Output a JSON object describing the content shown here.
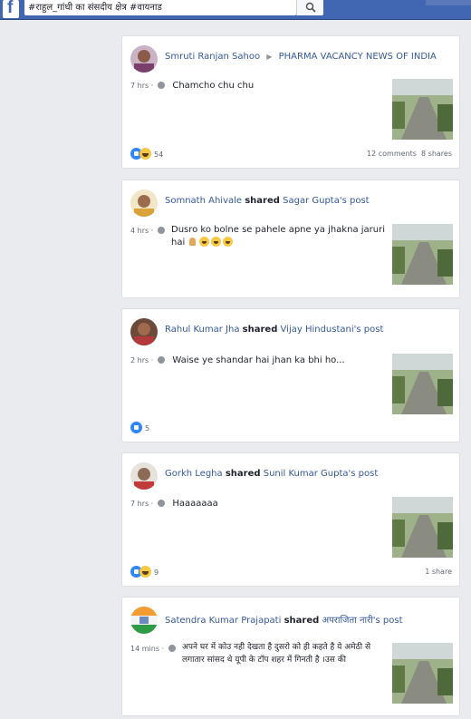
{
  "search": {
    "query": "#राहुल_गांधी का संसदीय क्षेत्र #वायनाड"
  },
  "posts": [
    {
      "author": "Smruti Ranjan Sahoo",
      "connector": "▶",
      "target": "PHARMA VACANCY NEWS OF INDIA",
      "time": "7 hrs",
      "text": "Chamcho chu chu",
      "reactions": "54",
      "comments": "12 comments",
      "shares": "8 shares"
    },
    {
      "author": "Somnath Ahivale",
      "shared_word": "shared",
      "target": "Sagar Gupta's post",
      "time": "4 hrs",
      "text": "Dusro ko bolne se pahele apne ya jhakna jaruri hai"
    },
    {
      "author": "Rahul Kumar Jha",
      "shared_word": "shared",
      "target": "Vijay Hindustani's post",
      "time": "2 hrs",
      "text": "Waise ye shandar hai jhan ka bhi ho...",
      "reactions": "5"
    },
    {
      "author": "Gorkh Legha",
      "shared_word": "shared",
      "target": "Sunil Kumar Gupta's post",
      "time": "7 hrs",
      "text": "Haaaaaaa",
      "reactions": "9",
      "shares": "1 share"
    },
    {
      "author": "Satendra Kumar Prajapati",
      "shared_word": "shared",
      "target": "अपराजिता नारी's post",
      "time": "14 mins",
      "text": "अपने घर में कोउ नही देखता है दुसरो को ही कहते है ये अमेठी से लगातार सांसद थे यूपी के टॉप शहर में गिनती है ।उस की"
    }
  ],
  "colors": {
    "topbar": "#4267b2",
    "link": "#365899",
    "background": "#e9ebee"
  }
}
